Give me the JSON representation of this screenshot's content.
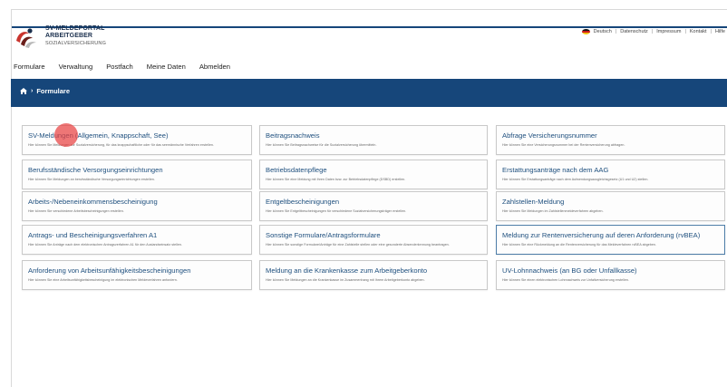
{
  "brand": {
    "line1": "SV-MELDEPORTAL",
    "line2": "ARBEITGEBER",
    "line3": "SOZIALVERSICHERUNG"
  },
  "utility": {
    "items": [
      "Deutsch",
      "Datenschutz",
      "Impressum",
      "Kontakt",
      "Hilfe"
    ]
  },
  "nav": {
    "items": [
      "Formulare",
      "Verwaltung",
      "Postfach",
      "Meine Daten",
      "Abmelden"
    ]
  },
  "breadcrumb": {
    "current": "Formulare"
  },
  "cards": [
    {
      "title": "SV-Meldungen (Allgemein, Knappschaft, See)",
      "desc": "Hier können Sie Meldungen zur Sozialversicherung, für das knappschaftliche oder für das seemännische Verfahren erstellen."
    },
    {
      "title": "Beitragsnachweis",
      "desc": "Hier können Sie Beitragsnachweise für die Sozialversicherung übermitteln."
    },
    {
      "title": "Abfrage Versicherungsnummer",
      "desc": "Hier können Sie eine Versicherungsnummer bei der Rentenversicherung abfragen."
    },
    {
      "title": "Berufsständische Versorgungseinrichtungen",
      "desc": "Hier können Sie Meldungen an berufsständische Versorgungseinrichtungen erstellen."
    },
    {
      "title": "Betriebsdatenpflege",
      "desc": "Hier können Sie eine Meldung mit Ihren Daten bzw. zur Betriebsdatenpflege (DSBD) erstellen."
    },
    {
      "title": "Erstattungsanträge nach dem AAG",
      "desc": "Hier können Sie Erstattungsanträge nach dem Aufwendungsausgleichsgesetz (U1 und U2) stellen."
    },
    {
      "title": "Arbeits-/Nebeneinkommensbescheinigung",
      "desc": "Hier können Sie verschiedene Arbeitsbescheinigungen erstellen."
    },
    {
      "title": "Entgeltbescheinigungen",
      "desc": "Hier können Sie Entgeltbescheinigungen für verschiedene Sozialversicherungsträger erstellen."
    },
    {
      "title": "Zahlstellen-Meldung",
      "desc": "Hier können Sie Meldungen im Zahlstellenmeldeverfahren abgeben."
    },
    {
      "title": "Antrags- und Bescheinigungsverfahren A1",
      "desc": "Hier können Sie Anträge nach dem elektronischen Antragsverfahren A1 für den Auslandseinsatz stellen."
    },
    {
      "title": "Sonstige Formulare/Antragsformulare",
      "desc": "Hier können Sie sonstige Formulare/Anträge für eine Zahlstelle stellen oder eine gesonderte Absenderkennung beantragen."
    },
    {
      "title": "Meldung zur Rentenversicherung auf deren Anforderung (rvBEA)",
      "desc": "Hier können Sie eine Rückmeldung an die Rentenversicherung für das Meldeverfahren rvBEA abgeben."
    },
    {
      "title": "Anforderung von Arbeitsunfähigkeitsbescheinigungen",
      "desc": "Hier können Sie eine Arbeitsunfähigkeitsbescheinigung im elektronischen Meldeverfahren anfordern."
    },
    {
      "title": "Meldung an die Krankenkasse zum Arbeitgeberkonto",
      "desc": "Hier können Sie Meldungen an die Krankenkasse im Zusammenhang mit Ihrem Arbeitgeberkonto abgeben."
    },
    {
      "title": "UV-Lohnnachweis (an BG oder Unfallkasse)",
      "desc": "Hier können Sie einen elektronischen Lohnnachweis zur Unfallversicherung erstellen."
    }
  ],
  "colors": {
    "primary": "#16467a",
    "link": "#1e4f7e",
    "cursor": "#e84141"
  }
}
